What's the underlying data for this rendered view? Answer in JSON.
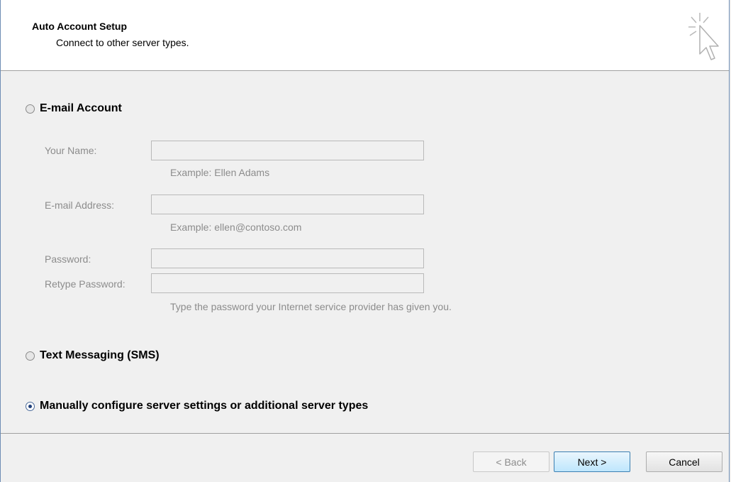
{
  "header": {
    "title": "Auto Account Setup",
    "subtitle": "Connect to other server types."
  },
  "options": {
    "email_account": {
      "label": "E-mail Account",
      "selected": false,
      "fields": {
        "your_name": {
          "label": "Your Name:",
          "value": "",
          "hint": "Example: Ellen Adams"
        },
        "email_address": {
          "label": "E-mail Address:",
          "value": "",
          "hint": "Example: ellen@contoso.com"
        },
        "password": {
          "label": "Password:",
          "value": ""
        },
        "retype_password": {
          "label": "Retype Password:",
          "value": "",
          "hint": "Type the password your Internet service provider has given you."
        }
      }
    },
    "sms": {
      "label": "Text Messaging (SMS)",
      "selected": false
    },
    "manual": {
      "label": "Manually configure server settings or additional server types",
      "selected": true
    }
  },
  "buttons": {
    "back": "< Back",
    "next": "Next >",
    "cancel": "Cancel"
  },
  "icons": {
    "header": "cursor-click-icon"
  },
  "colors": {
    "frame_border": "#6e8db4",
    "background": "#f0f0f0",
    "header_bg": "#ffffff",
    "disabled_text": "#8c8c8c"
  }
}
